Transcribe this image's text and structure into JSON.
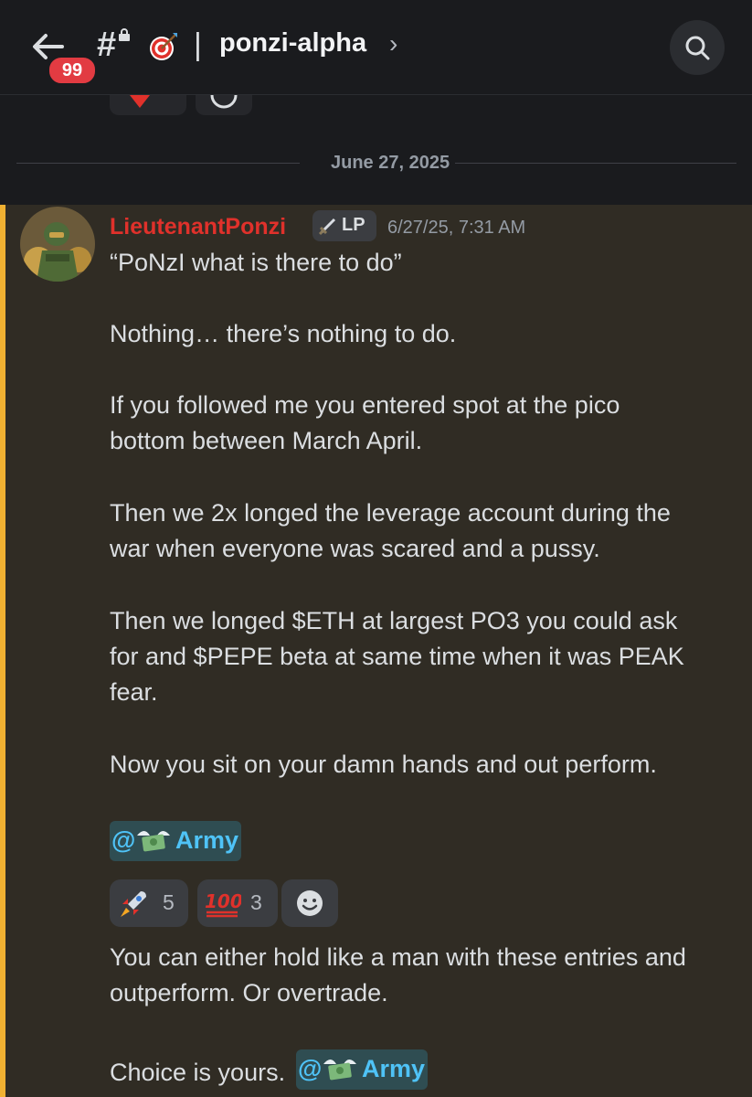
{
  "header": {
    "unread_count": "99",
    "channel_name": "ponzi-alpha",
    "icons": [
      "back-arrow-icon",
      "hash-lock-icon",
      "target-icon",
      "chevron-right-icon",
      "search-icon"
    ]
  },
  "date_divider": "June 27, 2025",
  "message": {
    "username": "LieutenantPonzi",
    "username_color": "#e0312b",
    "role_tag": "LP",
    "timestamp": "6/27/25, 7:31 AM",
    "lines": [
      "“PoNzI what is there to do”",
      "Nothing… there’s nothing to do.",
      "If you followed me you entered spot at the pico",
      "bottom between March April.",
      "Then we 2x longed the leverage account during the",
      "war when everyone was scared and a pussy.",
      "Then we longed $ETH at largest PO3 you could ask",
      "for and $PEPE beta at same time when it was PEAK",
      "fear.",
      "Now you sit on your damn hands and out perform."
    ],
    "mention_1": {
      "at": "@",
      "role": "Army"
    },
    "reactions": [
      {
        "icon": "rocket-icon",
        "count": "5"
      },
      {
        "icon": "hundred-points-icon",
        "count": "3"
      },
      {
        "icon": "add-reaction-icon"
      }
    ],
    "followup_lines": [
      "You can either hold like a man with these entries and",
      "outperform. Or overtrade."
    ],
    "choice_text": "Choice is yours.",
    "mention_2": {
      "at": "@",
      "role": "Army"
    }
  }
}
